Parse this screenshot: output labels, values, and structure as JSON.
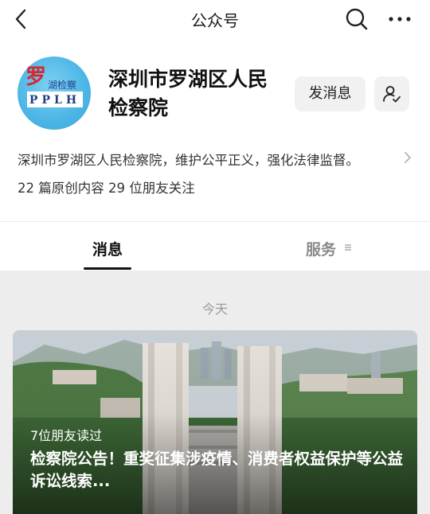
{
  "topbar": {
    "title": "公众号",
    "back_icon": "chevron-left-icon",
    "search_icon": "search-icon",
    "more_icon": "more-horizontal-icon"
  },
  "account": {
    "logo_text": {
      "big_char": "罗",
      "line1": "湖检察",
      "line2": "PPLH"
    },
    "name": "深圳市罗湖区人民检察院",
    "message_button": "发消息",
    "follow_icon": "user-check-icon",
    "description": "深圳市罗湖区人民检察院，维护公平正义，强化法律监督。",
    "stats": "22 篇原创内容  29 位朋友关注"
  },
  "tabs": {
    "messages": "消息",
    "services": "服务",
    "services_icon": "menu-lines-icon"
  },
  "feed": {
    "date_label": "今天",
    "article": {
      "read_count": "7位朋友读过",
      "title": "检察院公告！重奖征集涉疫情、消费者权益保护等公益诉讼线索..."
    }
  },
  "colors": {
    "logo_bg": "#4bb5e6",
    "logo_red": "#d7262c",
    "logo_navy": "#1f3f8a",
    "feed_bg": "#ededed"
  }
}
